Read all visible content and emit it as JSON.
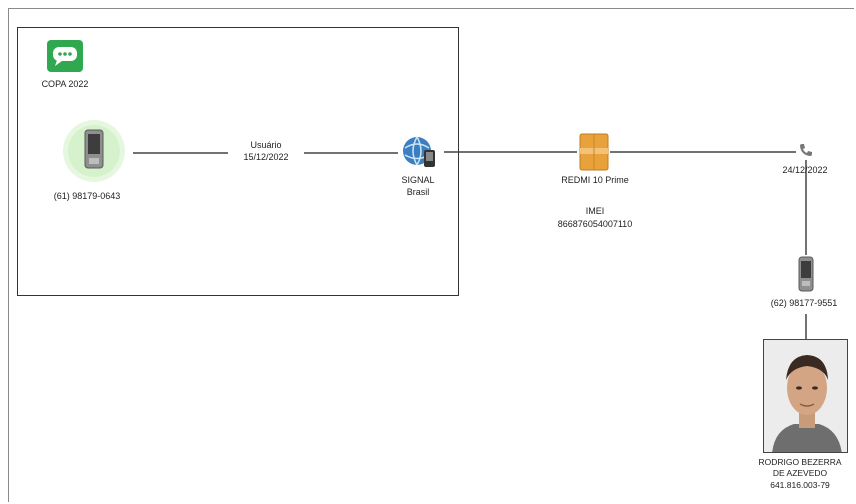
{
  "group": {
    "app_label": "COPA 2022",
    "app_icon": "chat-app-icon"
  },
  "phone1": {
    "number": "(61) 98179-0643",
    "icon": "mobile-phone-icon"
  },
  "edge1": {
    "line1": "Usuário",
    "line2": "15/12/2022"
  },
  "signal": {
    "line1": "SIGNAL",
    "line2": "Brasil",
    "icon": "globe-phone-icon"
  },
  "device": {
    "name": "REDMI 10 Prime",
    "imei_label": "IMEI",
    "imei": "866876054007110",
    "icon": "device-box-icon"
  },
  "date_node": {
    "date": "24/12/2022",
    "icon": "phone-call-icon"
  },
  "phone2": {
    "number": "(62) 98177-9551",
    "icon": "mobile-phone-icon"
  },
  "person": {
    "name_line1": "RODRIGO BEZERRA",
    "name_line2": "DE AZEVEDO",
    "cpf": "641.816.003-79",
    "icon": "person-photo"
  },
  "colors": {
    "chat_green": "#2fa84f",
    "device_orange": "#e9a23b",
    "globe_blue": "#2f6fa8",
    "line": "#444444"
  }
}
